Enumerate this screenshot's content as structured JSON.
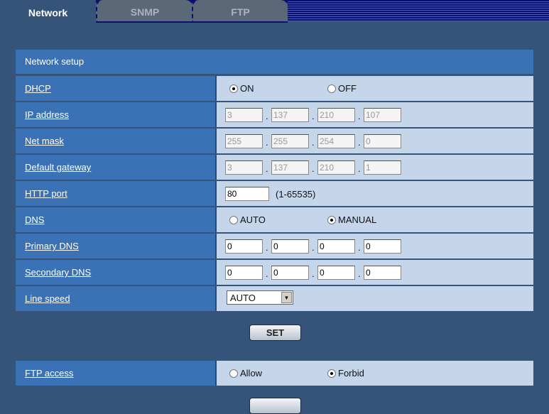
{
  "tabs": [
    {
      "label": "Network",
      "active": true
    },
    {
      "label": "SNMP"
    },
    {
      "label": "FTP"
    }
  ],
  "section_title": "Network setup",
  "dhcp": {
    "label": "DHCP",
    "on": "ON",
    "off": "OFF",
    "selected": "ON"
  },
  "ip_address": {
    "label": "IP address",
    "values": [
      "3",
      "137",
      "210",
      "107"
    ]
  },
  "net_mask": {
    "label": "Net mask",
    "values": [
      "255",
      "255",
      "254",
      "0"
    ]
  },
  "default_gateway": {
    "label": "Default gateway",
    "values": [
      "3",
      "137",
      "210",
      "1"
    ]
  },
  "http_port": {
    "label": "HTTP port",
    "value": "80",
    "range": "(1-65535)"
  },
  "dns": {
    "label": "DNS",
    "auto": "AUTO",
    "manual": "MANUAL",
    "selected": "MANUAL"
  },
  "primary_dns": {
    "label": "Primary DNS",
    "values": [
      "0",
      "0",
      "0",
      "0"
    ]
  },
  "secondary_dns": {
    "label": "Secondary DNS",
    "values": [
      "0",
      "0",
      "0",
      "0"
    ]
  },
  "line_speed": {
    "label": "Line speed",
    "value": "AUTO"
  },
  "set_label": "SET",
  "ftp_access": {
    "label": "FTP access",
    "allow": "Allow",
    "forbid": "Forbid",
    "selected": "Forbid"
  },
  "colors": {
    "background": "#365479",
    "label_cell": "#3a72b5",
    "value_cell": "#c5d6ea"
  }
}
